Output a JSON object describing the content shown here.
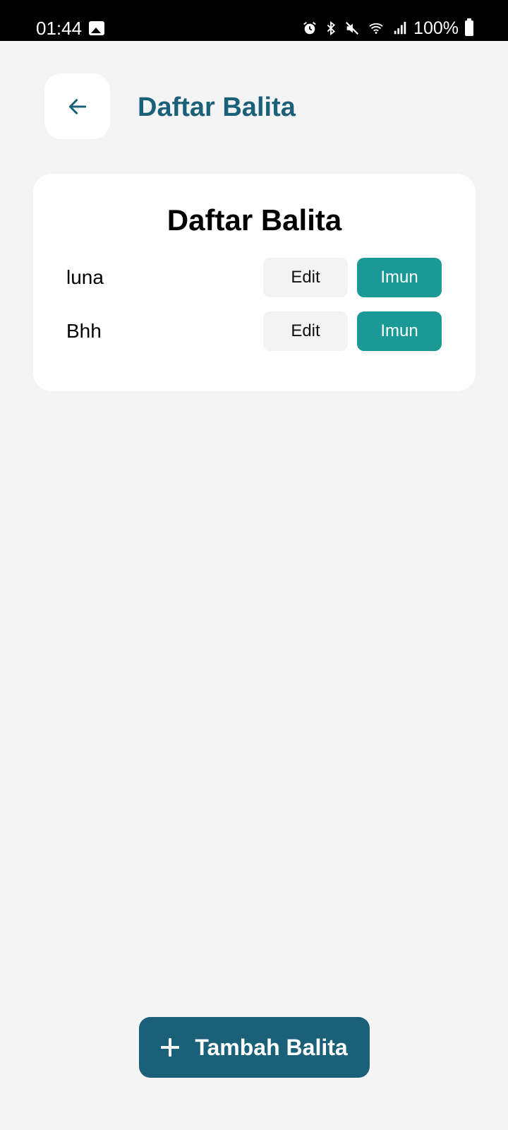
{
  "status_bar": {
    "time": "01:44",
    "battery_text": "100%",
    "icons": [
      "gallery-icon",
      "alarm-icon",
      "bluetooth-icon",
      "mute-icon",
      "wifi-icon",
      "signal-icon",
      "battery-icon"
    ]
  },
  "header": {
    "back_icon": "arrow-left-icon",
    "title": "Daftar Balita"
  },
  "card": {
    "title": "Daftar Balita",
    "rows": [
      {
        "name": "luna",
        "edit_label": "Edit",
        "imun_label": "Imun"
      },
      {
        "name": "Bhh",
        "edit_label": "Edit",
        "imun_label": "Imun"
      }
    ]
  },
  "fab": {
    "icon": "plus-icon",
    "label": "Tambah Balita"
  },
  "colors": {
    "primary": "#1b6079",
    "accent": "#1a9996",
    "background": "#f4f4f4",
    "card": "#ffffff"
  }
}
